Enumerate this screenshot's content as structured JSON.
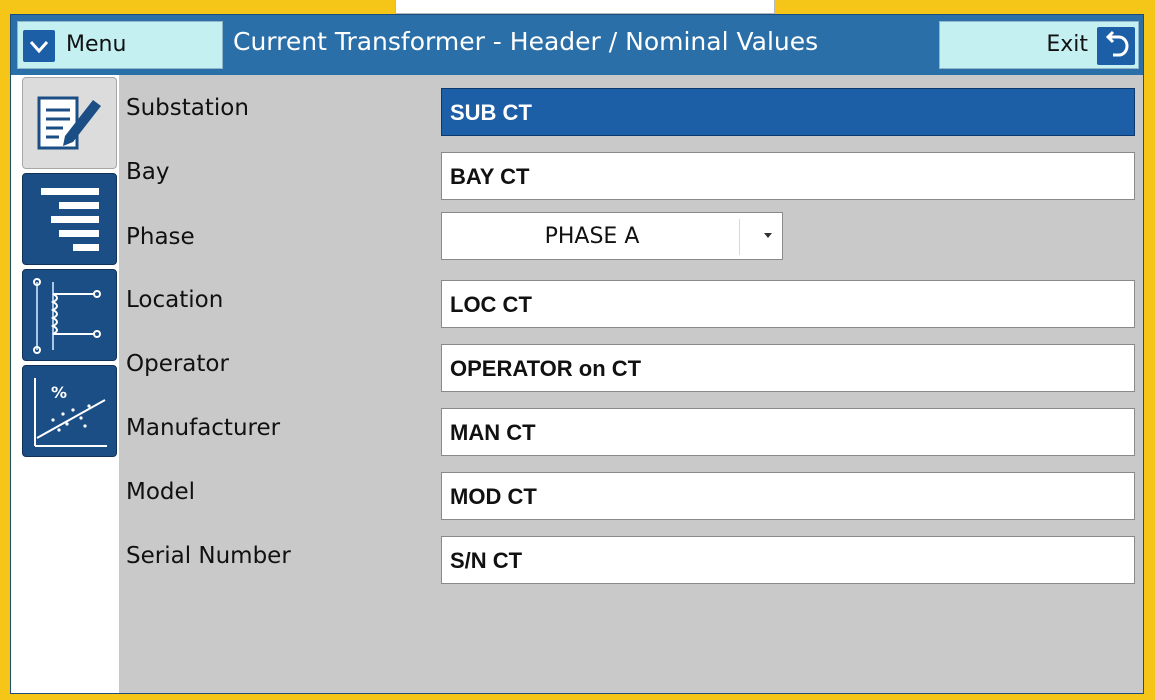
{
  "header": {
    "menu_label": "Menu",
    "title": "Current Transformer - Header / Nominal Values",
    "exit_label": "Exit"
  },
  "sidebar": {
    "items": [
      {
        "icon": "edit-document-icon",
        "active": true
      },
      {
        "icon": "list-align-icon",
        "active": false
      },
      {
        "icon": "transformer-coil-icon",
        "active": false
      },
      {
        "icon": "percent-chart-icon",
        "active": false
      }
    ]
  },
  "form": {
    "fields": [
      {
        "label": "Substation",
        "value": "SUB CT",
        "selected": true
      },
      {
        "label": "Bay",
        "value": "BAY CT"
      },
      {
        "label": "Phase",
        "value": "PHASE A",
        "type": "select"
      },
      {
        "label": "Location",
        "value": "LOC CT"
      },
      {
        "label": "Operator",
        "value": "OPERATOR on CT"
      },
      {
        "label": "Manufacturer",
        "value": "MAN CT"
      },
      {
        "label": "Model",
        "value": "MOD CT"
      },
      {
        "label": "Serial Number",
        "value": "S/N CT"
      }
    ]
  },
  "colors": {
    "accent": "#1d5fa6",
    "header_bg": "#2a6fa8",
    "button_bg": "#c5f0f2",
    "frame": "#f5c518",
    "panel_bg": "#c9c9c9"
  }
}
